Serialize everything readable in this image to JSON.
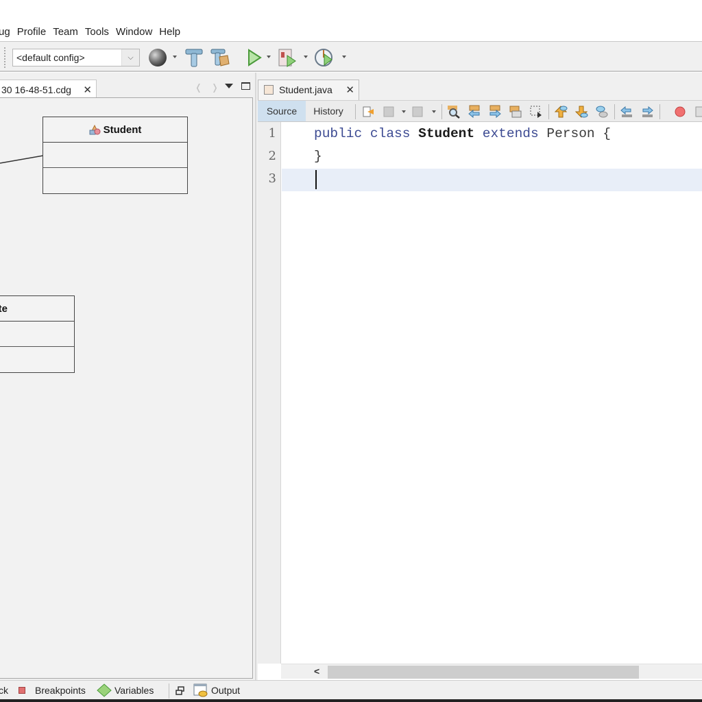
{
  "menu": {
    "items": [
      "ug",
      "Profile",
      "Team",
      "Tools",
      "Window",
      "Help"
    ]
  },
  "toolbar": {
    "config_value": "<default config>",
    "dropdown_chevron": "⌵",
    "icons": [
      "globe-icon",
      "build-hammer-icon",
      "clean-build-icon",
      "run-icon",
      "debug-icon",
      "profile-icon"
    ]
  },
  "left_panel": {
    "tab_label": "30 16-48-51.cdg",
    "close": "✕",
    "nav_prev": "❬",
    "nav_next": "❭",
    "diagram": {
      "classes": [
        {
          "name": "Student",
          "has_icon": true
        },
        {
          "name": "ate",
          "has_icon": false
        }
      ]
    }
  },
  "editor": {
    "tab_label": "Student.java",
    "close": "✕",
    "source_label": "Source",
    "history_label": "History",
    "line_numbers": [
      "1",
      "2",
      "3"
    ],
    "lines": [
      [
        {
          "t": "public ",
          "c": "kw"
        },
        {
          "t": "class ",
          "c": "kw"
        },
        {
          "t": "Student",
          "c": "cls"
        },
        {
          "t": " extends ",
          "c": "kw"
        },
        {
          "t": "Person {",
          "c": "id"
        }
      ],
      [
        {
          "t": "}",
          "c": "id"
        }
      ],
      []
    ],
    "scroll_left": "<"
  },
  "bottom": {
    "items": [
      "ck",
      "Breakpoints",
      "Variables",
      "Output"
    ]
  }
}
